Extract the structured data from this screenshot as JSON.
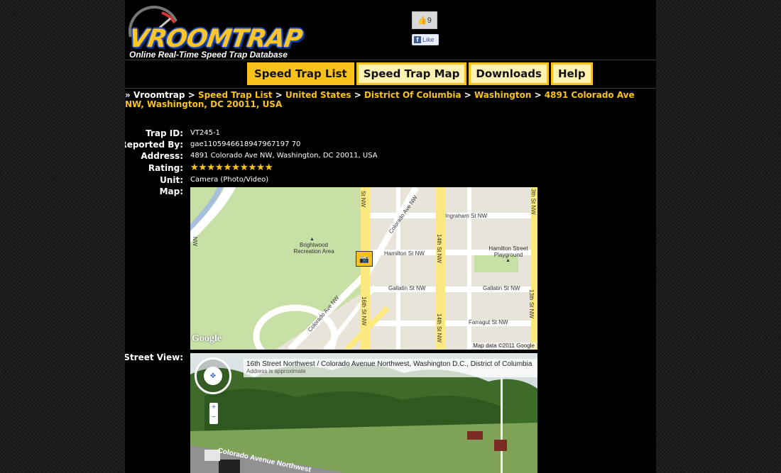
{
  "header": {
    "logo_text": "VROOMTRAP",
    "tagline": "Online Real-Time Speed Trap Database",
    "like_count": "9",
    "fb_like_label": "Like"
  },
  "nav": [
    {
      "label": "Speed Trap List",
      "active": true
    },
    {
      "label": "Speed Trap Map",
      "active": false
    },
    {
      "label": "Downloads",
      "active": false
    },
    {
      "label": "Help",
      "active": false
    }
  ],
  "breadcrumb": {
    "prefix": "»",
    "items": [
      "Vroomtrap",
      "Speed Trap List",
      "United States",
      "District Of Columbia",
      "Washington",
      "4891 Colorado Ave NW, Washington, DC 20011, USA"
    ],
    "separator": ">"
  },
  "trap": {
    "id_label": "Trap ID:",
    "id": "VT245-1",
    "reported_label": "Reported By:",
    "reported_by": "gae1105946618947967197 70",
    "address_label": "Address:",
    "address": "4891 Colorado Ave NW, Washington, DC 20011, USA",
    "rating_label": "Rating:",
    "rating": 10,
    "rating_max": 10,
    "unit_label": "Unit:",
    "unit": "Camera (Photo/Video)",
    "map_label": "Map:",
    "street_view_label": "Street View:"
  },
  "map": {
    "labels": {
      "ingraham": "Ingraham St NW",
      "hamilton": "Hamilton St NW",
      "hamilton_playground": "Hamilton Street Playground",
      "gallatin_left": "Gallatin St NW",
      "gallatin_right": "Gallatin St NW",
      "farragut": "Farragut St NW",
      "rec_area": "Brightwood Recreation Area",
      "colorado_top": "Colorado Ave NW",
      "colorado_bottom": "Colorado Ave NW",
      "sixteenth_top": "St NW",
      "sixteenth_bottom": "16th St NW",
      "fourteenth_top": "14th St NW",
      "fourteenth_bottom": "14th St NW",
      "thirteenth_top": "3th St NW",
      "thirteenth_bottom": "13th St NW",
      "nw_left": "NW"
    },
    "google": "Google",
    "attribution": "Map data ©2011 Google",
    "colors": {
      "land": "#e8e4da",
      "park": "#c8dfa6",
      "road": "#ffffff",
      "arterial": "#fbe87e",
      "water": "#a5bfdd"
    }
  },
  "street_view": {
    "title": "16th Street Northwest / Colorado Avenue Northwest, Washington D.C., District of Columbia",
    "subtitle": "Address is approximate",
    "road_label": "Colorado Avenue Northwest"
  }
}
